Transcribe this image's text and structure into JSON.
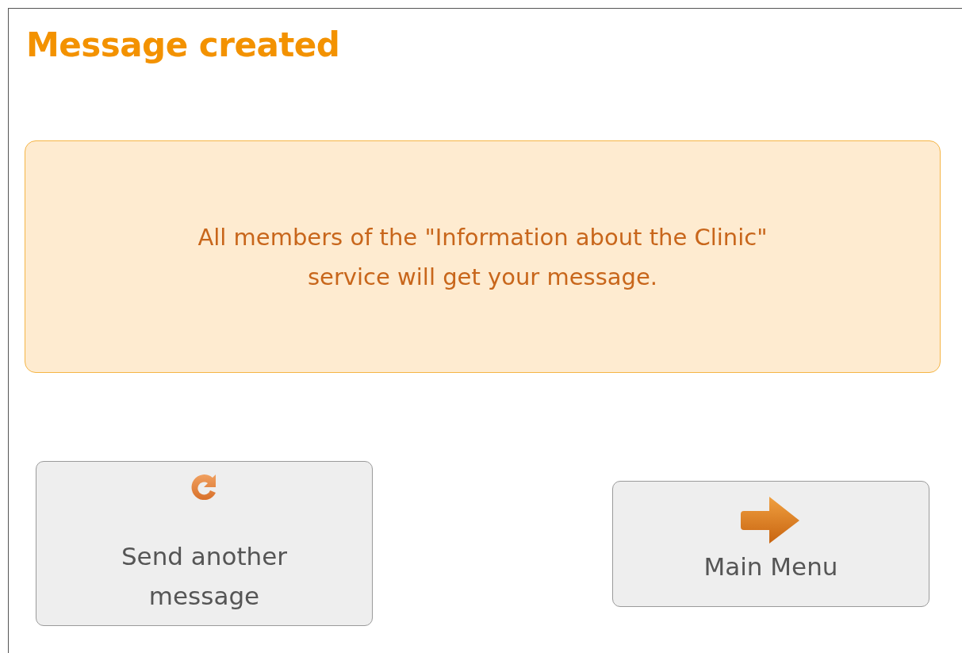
{
  "title": "Message created",
  "notice": {
    "text": "All members of the \"Information about the Clinic\" service will get your message."
  },
  "buttons": [
    {
      "label": "Send another message",
      "kind": "refresh"
    },
    {
      "label": "Main Menu",
      "kind": "forward"
    }
  ]
}
